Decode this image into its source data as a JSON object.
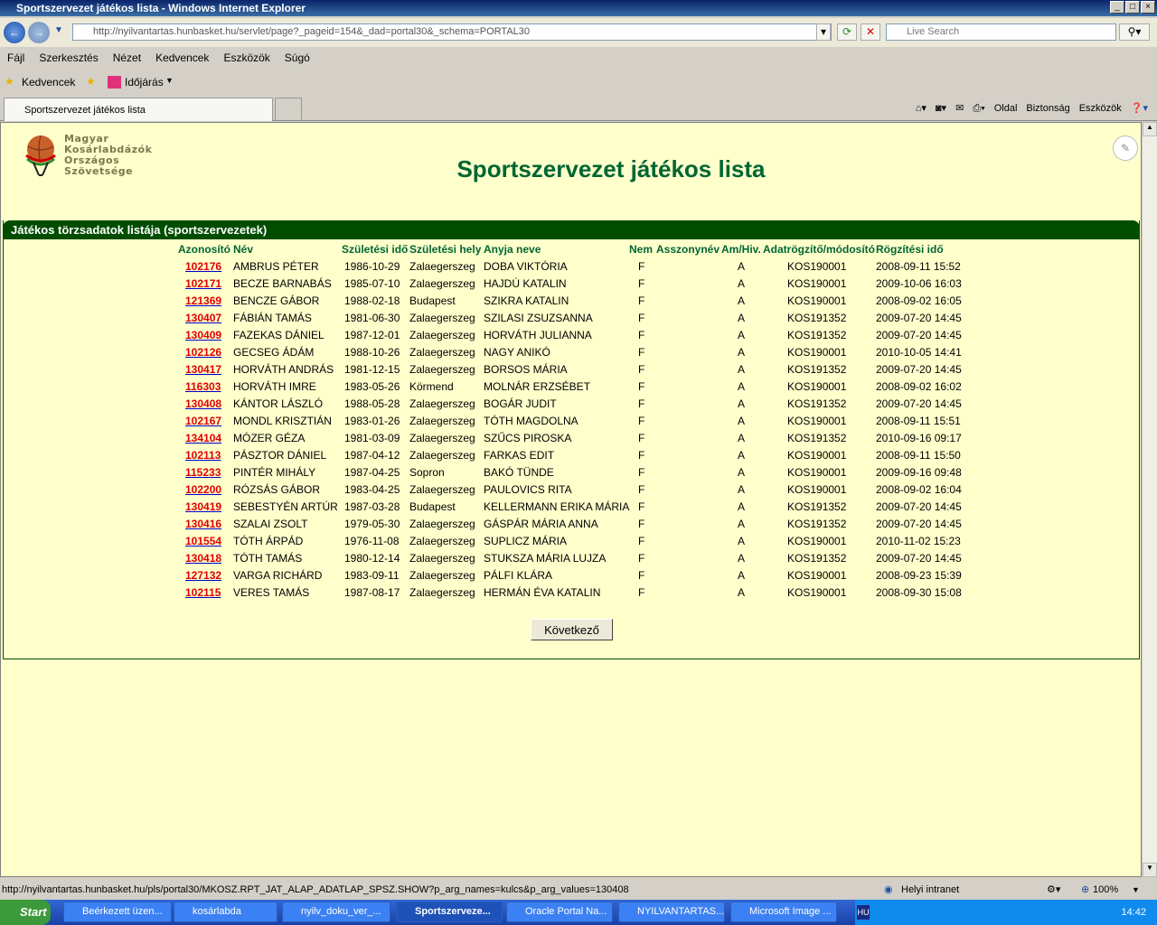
{
  "window": {
    "title": "Sportszervezet játékos lista - Windows Internet Explorer"
  },
  "address": {
    "url": "http://nyilvantartas.hunbasket.hu/servlet/page?_pageid=154&_dad=portal30&_schema=PORTAL30",
    "search_placeholder": "Live Search"
  },
  "menu": [
    "Fájl",
    "Szerkesztés",
    "Nézet",
    "Kedvencek",
    "Eszközök",
    "Súgó"
  ],
  "favorites": {
    "label": "Kedvencek",
    "weather": "Időjárás"
  },
  "tab": {
    "title": "Sportszervezet játékos lista"
  },
  "commands": [
    "Oldal",
    "Biztonság",
    "Eszközök"
  ],
  "logo": {
    "lines": [
      "Magyar",
      "Kosárlabdázók",
      "Országos",
      "Szövetsége"
    ]
  },
  "page": {
    "title": "Sportszervezet játékos lista",
    "panel_title": "Játékos törzsadatok listája (sportszervezetek)",
    "next_button": "Következő"
  },
  "table": {
    "headers": [
      "Azonosító",
      "Név",
      "Születési idő",
      "Születési hely",
      "Anyja neve",
      "Nem",
      "Asszonynév",
      "Am/Hiv.",
      "Adatrögzítő/módosító",
      "Rögzítési idő"
    ],
    "rows": [
      [
        "102176",
        "AMBRUS PÉTER",
        "1986-10-29",
        "Zalaegerszeg",
        "DOBA VIKTÓRIA",
        "F",
        "",
        "A",
        "KOS190001",
        "2008-09-11 15:52"
      ],
      [
        "102171",
        "BECZE BARNABÁS",
        "1985-07-10",
        "Zalaegerszeg",
        "HAJDÚ KATALIN",
        "F",
        "",
        "A",
        "KOS190001",
        "2009-10-06 16:03"
      ],
      [
        "121369",
        "BENCZE GÁBOR",
        "1988-02-18",
        "Budapest",
        "SZIKRA KATALIN",
        "F",
        "",
        "A",
        "KOS190001",
        "2008-09-02 16:05"
      ],
      [
        "130407",
        "FÁBIÁN TAMÁS",
        "1981-06-30",
        "Zalaegerszeg",
        "SZILASI ZSUZSANNA",
        "F",
        "",
        "A",
        "KOS191352",
        "2009-07-20 14:45"
      ],
      [
        "130409",
        "FAZEKAS DÁNIEL",
        "1987-12-01",
        "Zalaegerszeg",
        "HORVÁTH JULIANNA",
        "F",
        "",
        "A",
        "KOS191352",
        "2009-07-20 14:45"
      ],
      [
        "102126",
        "GECSEG ÁDÁM",
        "1988-10-26",
        "Zalaegerszeg",
        "NAGY ANIKÓ",
        "F",
        "",
        "A",
        "KOS190001",
        "2010-10-05 14:41"
      ],
      [
        "130417",
        "HORVÁTH ANDRÁS",
        "1981-12-15",
        "Zalaegerszeg",
        "BORSOS MÁRIA",
        "F",
        "",
        "A",
        "KOS191352",
        "2009-07-20 14:45"
      ],
      [
        "116303",
        "HORVÁTH IMRE",
        "1983-05-26",
        "Körmend",
        "MOLNÁR ERZSÉBET",
        "F",
        "",
        "A",
        "KOS190001",
        "2008-09-02 16:02"
      ],
      [
        "130408",
        "KÁNTOR LÁSZLÓ",
        "1988-05-28",
        "Zalaegerszeg",
        "BOGÁR JUDIT",
        "F",
        "",
        "A",
        "KOS191352",
        "2009-07-20 14:45"
      ],
      [
        "102167",
        "MONDL KRISZTIÁN",
        "1983-01-26",
        "Zalaegerszeg",
        "TÓTH MAGDOLNA",
        "F",
        "",
        "A",
        "KOS190001",
        "2008-09-11 15:51"
      ],
      [
        "134104",
        "MÓZER GÉZA",
        "1981-03-09",
        "Zalaegerszeg",
        "SZŰCS PIROSKA",
        "F",
        "",
        "A",
        "KOS191352",
        "2010-09-16 09:17"
      ],
      [
        "102113",
        "PÁSZTOR DÁNIEL",
        "1987-04-12",
        "Zalaegerszeg",
        "FARKAS EDIT",
        "F",
        "",
        "A",
        "KOS190001",
        "2008-09-11 15:50"
      ],
      [
        "115233",
        "PINTÉR MIHÁLY",
        "1987-04-25",
        "Sopron",
        "BAKÓ TÜNDE",
        "F",
        "",
        "A",
        "KOS190001",
        "2009-09-16 09:48"
      ],
      [
        "102200",
        "RÓZSÁS GÁBOR",
        "1983-04-25",
        "Zalaegerszeg",
        "PAULOVICS RITA",
        "F",
        "",
        "A",
        "KOS190001",
        "2008-09-02 16:04"
      ],
      [
        "130419",
        "SEBESTYÉN ARTÚR",
        "1987-03-28",
        "Budapest",
        "KELLERMANN ERIKA MÁRIA",
        "F",
        "",
        "A",
        "KOS191352",
        "2009-07-20 14:45"
      ],
      [
        "130416",
        "SZALAI ZSOLT",
        "1979-05-30",
        "Zalaegerszeg",
        "GÁSPÁR MÁRIA ANNA",
        "F",
        "",
        "A",
        "KOS191352",
        "2009-07-20 14:45"
      ],
      [
        "101554",
        "TÓTH ÁRPÁD",
        "1976-11-08",
        "Zalaegerszeg",
        "SUPLICZ MÁRIA",
        "F",
        "",
        "A",
        "KOS190001",
        "2010-11-02 15:23"
      ],
      [
        "130418",
        "TÓTH TAMÁS",
        "1980-12-14",
        "Zalaegerszeg",
        "STUKSZA MÁRIA LUJZA",
        "F",
        "",
        "A",
        "KOS191352",
        "2009-07-20 14:45"
      ],
      [
        "127132",
        "VARGA RICHÁRD",
        "1983-09-11",
        "Zalaegerszeg",
        "PÁLFI KLÁRA",
        "F",
        "",
        "A",
        "KOS190001",
        "2008-09-23 15:39"
      ],
      [
        "102115",
        "VERES TAMÁS",
        "1987-08-17",
        "Zalaegerszeg",
        "HERMÁN ÉVA KATALIN",
        "F",
        "",
        "A",
        "KOS190001",
        "2008-09-30 15:08"
      ]
    ]
  },
  "status": {
    "text": "http://nyilvantartas.hunbasket.hu/pls/portal30/MKOSZ.RPT_JAT_ALAP_ADATLAP_SPSZ.SHOW?p_arg_names=kulcs&p_arg_values=130408",
    "zone": "Helyi intranet",
    "zoom": "100%"
  },
  "taskbar": {
    "start": "Start",
    "tasks": [
      "Beérkezett üzen...",
      "kosárlabda",
      "nyilv_doku_ver_...",
      "Sportszerveze...",
      "Oracle Portal Na...",
      "NYILVANTARTAS...",
      "Microsoft Image ..."
    ],
    "clock": "14:42",
    "lang": "HU"
  },
  "colors": {
    "accent": "#004d00",
    "title": "#006633",
    "page_bg": "#ffffcc",
    "link": "#e00000"
  }
}
